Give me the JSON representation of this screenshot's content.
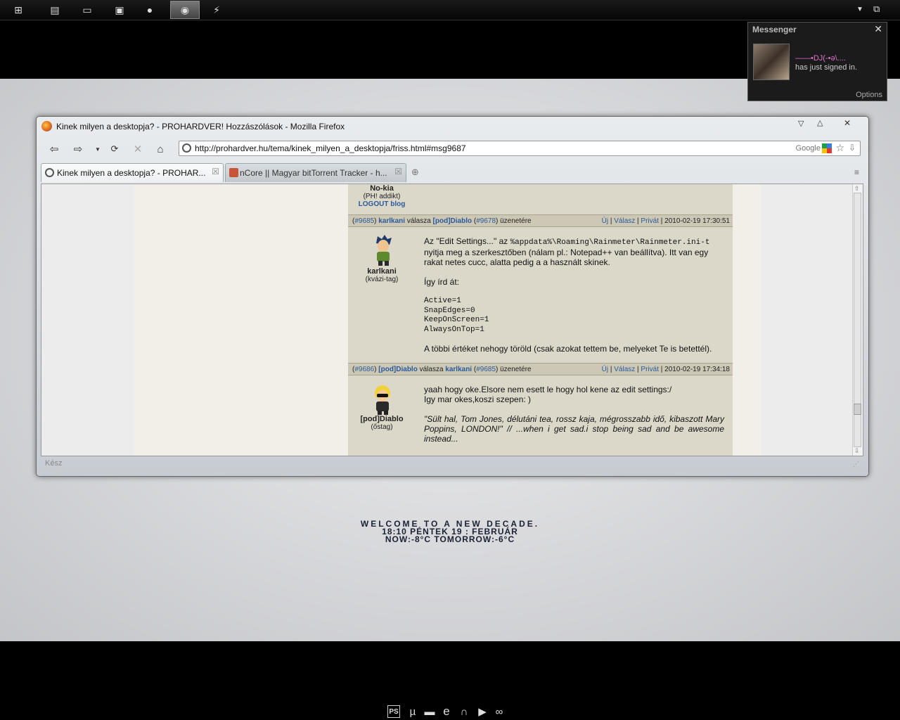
{
  "taskbar": {
    "buttons": [
      "windows-logo-icon",
      "library-icon",
      "folder-icon",
      "computer-icon",
      "user-icon",
      "media-player-icon",
      "lightning-icon"
    ],
    "right_icons": [
      "dropdown-arrow-icon",
      "show-desktop-icon"
    ]
  },
  "messenger": {
    "title": "Messenger",
    "close": "✕",
    "contact_name": "——•DJ(-•ə\\....",
    "status_text": "has just signed in.",
    "options": "Options"
  },
  "browser": {
    "window_title": "Kinek milyen a desktopja? - PROHARDVER! Hozzászólások - Mozilla Firefox",
    "url": "http://prohardver.hu/tema/kinek_milyen_a_desktopja/friss.html#msg9687",
    "search_engine": "Google",
    "tabs": [
      {
        "label": "Kinek milyen a desktopja? - PROHAR...",
        "active": true
      },
      {
        "label": "nCore || Magyar bitTorrent Tracker - h...",
        "active": false
      }
    ],
    "status": "Kész"
  },
  "forum": {
    "prev_user": {
      "name": "No-kia",
      "rank": "(PH! addikt)",
      "link": "LOGOUT blog"
    },
    "posts": [
      {
        "num": "#9685",
        "author": "karlkani",
        "reply_word": "válasza",
        "reply_to": "[pod]Diablo",
        "reply_num": "#9678",
        "suffix": "üzenetére",
        "actions": [
          "Új",
          "Válasz",
          "Privát"
        ],
        "date": "2010-02-19 17:30:51",
        "rank": "(kvázi-tag)",
        "line1_a": "Az \"Edit Settings...\" az ",
        "line1_code": "%appdata%\\Roaming\\Rainmeter\\Rainmeter.ini-t",
        "line2": "nyitja meg a szerkesztőben (nálam pl.: Notepad++ van beállítva). Itt van egy rakat netes cucc, alatta pedig a a használt skinek.",
        "line3": "Így írd át:",
        "code": [
          "Active=1",
          "SnapEdges=0",
          "KeepOnScreen=1",
          "AlwaysOnTop=1"
        ],
        "line4": "A többi értéket nehogy töröld (csak azokat tettem be, melyeket Te is betettél)."
      },
      {
        "num": "#9686",
        "author": "[pod]Diablo",
        "reply_word": "válasza",
        "reply_to": "karlkani",
        "reply_num": "#9685",
        "suffix": "üzenetére",
        "actions": [
          "Új",
          "Válasz",
          "Privát"
        ],
        "date": "2010-02-19 17:34:18",
        "rank": "(őstag)",
        "line1": "yaah hogy oke.Elsore nem esett le hogy hol kene az edit settings:/",
        "line2": "Igy mar okes,koszi szepen: )",
        "signature": "\"Sült hal, Tom Jones, délutáni tea, rossz kaja, mégrosszabb idő, kibaszott Mary Poppins, LONDON!\" // ...when i get sad.i stop being sad and be awesome instead..."
      }
    ]
  },
  "desktop_widget": {
    "line1": "WELCOME TO A NEW DECADE.",
    "line2": "18:10  PÉNTEK 19  :  FEBRUÁR",
    "line3": "NOW:-8°C TOMORROW:-6°C"
  },
  "dock": [
    "photoshop-icon",
    "utorrent-icon",
    "folder-icon",
    "internet-explorer-icon",
    "headphones-icon",
    "play-icon",
    "infinity-icon"
  ]
}
